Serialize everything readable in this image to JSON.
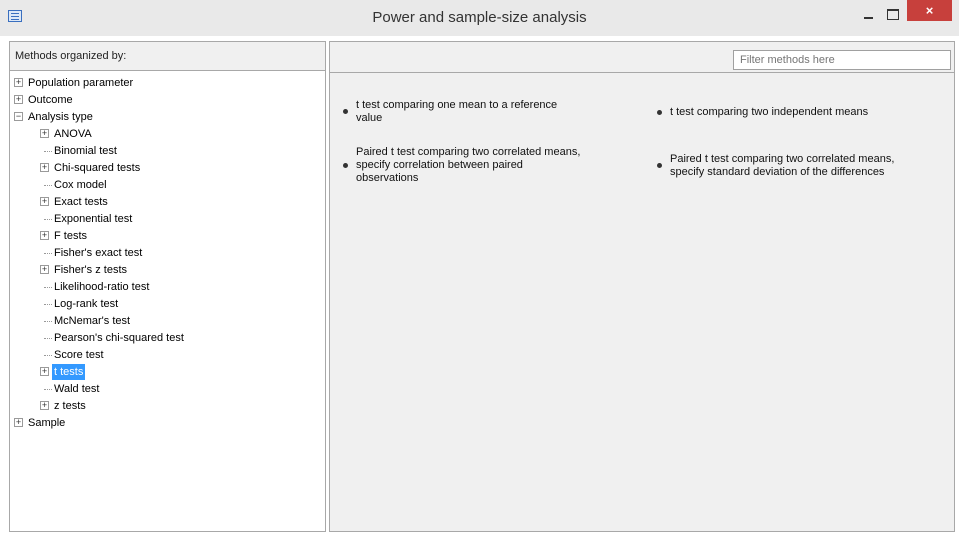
{
  "window": {
    "title": "Power and sample-size analysis",
    "close_glyph": "×",
    "icons": {
      "app": "window-app-icon",
      "minimize": "minimize-icon",
      "maximize": "maximize-icon",
      "close": "close-icon"
    },
    "colors": {
      "close_button": "#c7403c",
      "selection": "#3399ff"
    }
  },
  "left_panel": {
    "header": "Methods organized by:",
    "tree": [
      {
        "label": "Population parameter",
        "expander": "+"
      },
      {
        "label": "Outcome",
        "expander": "+"
      },
      {
        "label": "Analysis type",
        "expander": "−"
      },
      {
        "label": "ANOVA",
        "expander": "+"
      },
      {
        "label": "Binomial test"
      },
      {
        "label": "Chi-squared tests",
        "expander": "+"
      },
      {
        "label": "Cox model"
      },
      {
        "label": "Exact tests",
        "expander": "+"
      },
      {
        "label": "Exponential test"
      },
      {
        "label": "F tests",
        "expander": "+"
      },
      {
        "label": "Fisher's exact test"
      },
      {
        "label": "Fisher's z tests",
        "expander": "+"
      },
      {
        "label": "Likelihood-ratio test"
      },
      {
        "label": "Log-rank test"
      },
      {
        "label": "McNemar's test"
      },
      {
        "label": "Pearson's chi-squared test"
      },
      {
        "label": "Score test"
      },
      {
        "label": "t tests",
        "expander": "+",
        "selected": true
      },
      {
        "label": "Wald test"
      },
      {
        "label": "z tests",
        "expander": "+"
      },
      {
        "label": "Sample",
        "expander": "+"
      }
    ]
  },
  "right_panel": {
    "filter_placeholder": "Filter methods here",
    "methods": [
      {
        "lines": [
          "t test comparing one mean to a reference",
          "value"
        ]
      },
      {
        "lines": [
          "t test comparing two independent means"
        ]
      },
      {
        "lines": [
          "Paired t test comparing two correlated means,",
          "specify correlation between paired",
          "observations"
        ]
      },
      {
        "lines": [
          "Paired t test comparing two correlated means,",
          "specify standard deviation of the differences"
        ]
      }
    ]
  }
}
